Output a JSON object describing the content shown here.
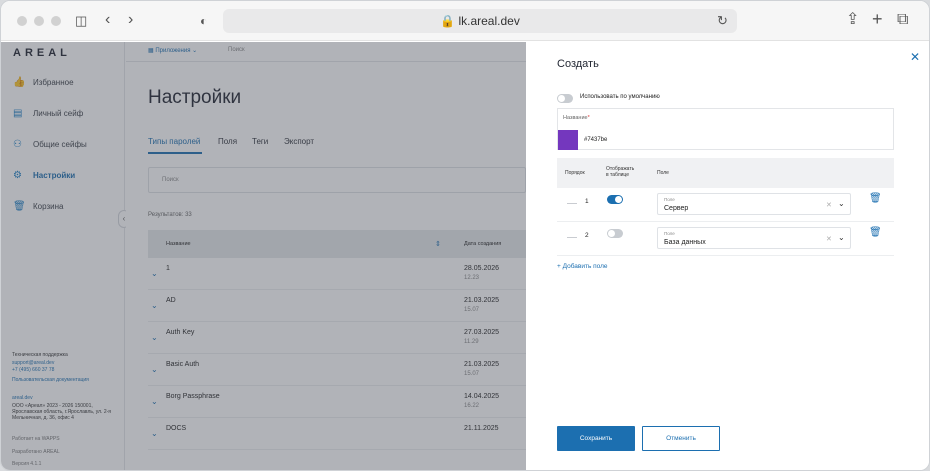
{
  "browser": {
    "url": "lk.areal.dev"
  },
  "sidebar": {
    "logo": "AREAL",
    "items": [
      {
        "label": "Избранное",
        "icon": "thumbs-up-icon"
      },
      {
        "label": "Личный сейф",
        "icon": "safe-icon"
      },
      {
        "label": "Общие сейфы",
        "icon": "users-icon"
      },
      {
        "label": "Настройки",
        "icon": "gear-icon",
        "active": true
      },
      {
        "label": "Корзина",
        "icon": "trash-icon"
      }
    ],
    "footer": {
      "support_title": "Техническая поддержка",
      "support_email": "support@areal.dev",
      "support_phone": "+7 (495) 660 37 78",
      "docs_link": "Пользовательская документация",
      "site": "areal.dev",
      "company_1": "ООО «Ареал» 2023 - 2026 150001,",
      "company_2": "Ярославская область, г.Ярославль, ул. 2-я",
      "company_3": "Мельничная, д. 36, офис 4",
      "works_on": "Работает на WAPPS",
      "developer": "Разработано AREAL",
      "version": "Версия 4.1.1"
    }
  },
  "main": {
    "apps_button": "Приложения",
    "search_placeholder": "Поиск",
    "title": "Настройки",
    "tabs": [
      "Типы паролей",
      "Поля",
      "Теги",
      "Экспорт"
    ],
    "filter_placeholder": "Поиск",
    "results": "Результатов: 33",
    "table": {
      "col_name": "Название",
      "col_date": "Дата создания",
      "rows": [
        {
          "name": "1",
          "date": "28.05.2026",
          "time": "12.23"
        },
        {
          "name": "AD",
          "date": "21.03.2025",
          "time": "15.07"
        },
        {
          "name": "Auth Key",
          "date": "27.03.2025",
          "time": "11.29"
        },
        {
          "name": "Basic Auth",
          "date": "21.03.2025",
          "time": "15.07"
        },
        {
          "name": "Borg Passphrase",
          "date": "14.04.2025",
          "time": "16.22"
        },
        {
          "name": "DOCS",
          "date": "21.11.2025",
          "time": ""
        }
      ]
    }
  },
  "panel": {
    "title": "Создать",
    "use_default": "Использовать по умолчанию",
    "name_label": "Название",
    "required_mark": "*",
    "color_hex": "#7437be",
    "fields_header": {
      "order": "Порядок",
      "show_1": "Отображать",
      "show_2": "в таблице",
      "field": "Поле"
    },
    "fields": [
      {
        "order": "1",
        "on": true,
        "label": "Поле",
        "value": "Сервер"
      },
      {
        "order": "2",
        "on": false,
        "label": "Поле",
        "value": "База данных"
      }
    ],
    "add_field": "Добавить поле",
    "save": "Сохранить",
    "cancel": "Отменить"
  }
}
